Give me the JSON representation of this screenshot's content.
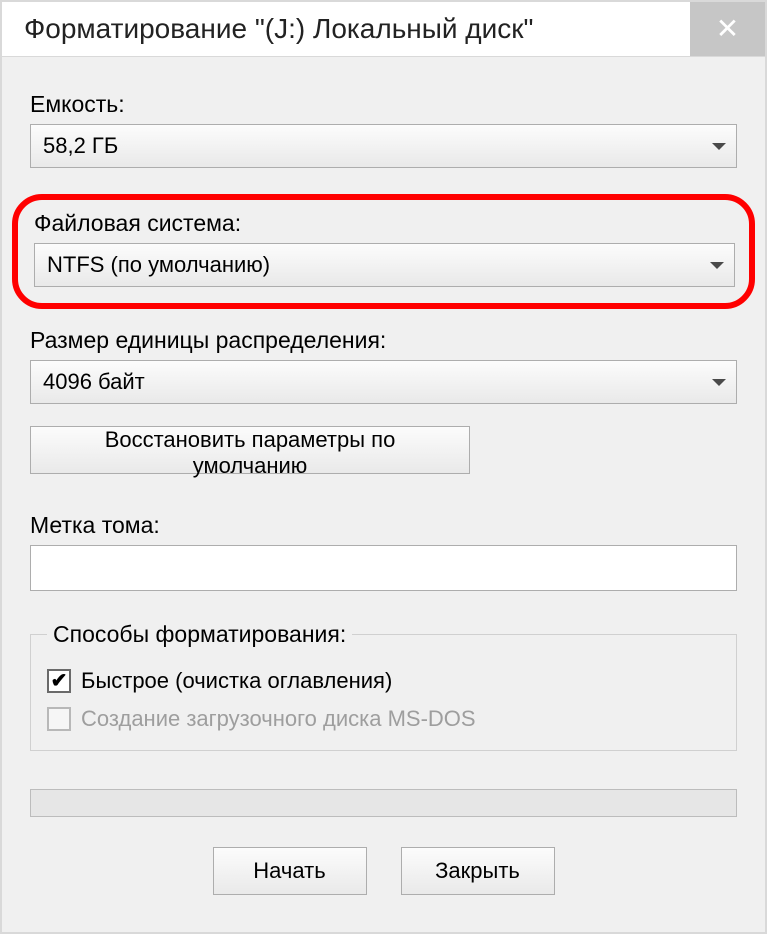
{
  "window": {
    "title": "Форматирование \"(J:) Локальный диск\"",
    "close_glyph": "✕"
  },
  "capacity": {
    "label": "Емкость:",
    "value": "58,2 ГБ"
  },
  "filesystem": {
    "label": "Файловая система:",
    "value": "NTFS (по умолчанию)"
  },
  "allocation": {
    "label": "Размер единицы распределения:",
    "value": "4096 байт"
  },
  "restore_button": "Восстановить параметры по умолчанию",
  "volume_label": {
    "label": "Метка тома:",
    "value": ""
  },
  "format_options": {
    "legend": "Способы форматирования:",
    "quick": {
      "label": "Быстрое (очистка оглавления)",
      "checked": true,
      "check_glyph": "✔"
    },
    "msdos": {
      "label": "Создание загрузочного диска MS-DOS",
      "checked": false,
      "enabled": false
    }
  },
  "buttons": {
    "start": "Начать",
    "close": "Закрыть"
  },
  "annotation": {
    "highlight_color": "#ff0000"
  }
}
